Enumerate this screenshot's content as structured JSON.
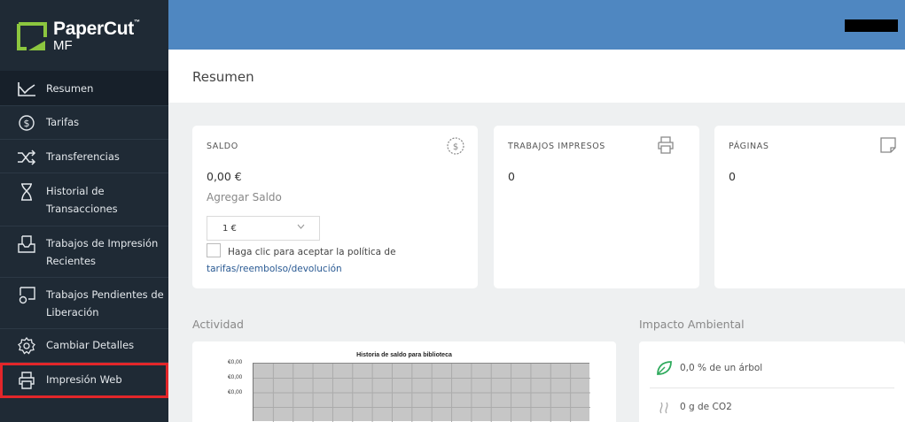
{
  "brand": {
    "name": "PaperCut",
    "trademark": "™",
    "edition": "MF",
    "colors": {
      "green": "#8cc63f",
      "sidebar": "#1f2a35",
      "topbar": "#4f87c1",
      "highlight": "#e3262a",
      "link": "#2a5a93"
    }
  },
  "sidebar": {
    "items": [
      {
        "label": "Resumen",
        "icon": "chart-line-icon",
        "active": true
      },
      {
        "label": "Tarifas",
        "icon": "dollar-circle-icon"
      },
      {
        "label": "Transferencias",
        "icon": "shuffle-icon"
      },
      {
        "label_lines": [
          "Historial de",
          "Transacciones"
        ],
        "icon": "hourglass-icon"
      },
      {
        "label_lines": [
          "Trabajos de Impresión",
          "Recientes"
        ],
        "icon": "tray-icon"
      },
      {
        "label_lines": [
          "Trabajos Pendientes de",
          "Liberación"
        ],
        "icon": "pending-print-icon"
      },
      {
        "label": "Cambiar Detalles",
        "icon": "gear-icon"
      },
      {
        "label": "Impresión Web",
        "icon": "printer-icon",
        "highlighted": true
      }
    ]
  },
  "header": {
    "title": "Resumen"
  },
  "cards": {
    "saldo": {
      "title": "SALDO",
      "icon": "dollar-circle-icon",
      "value": "0,00 €",
      "add_label": "Agregar Saldo",
      "select_value": "1 €",
      "policy_text": "Haga clic para aceptar la política de",
      "policy_link": "tarifas/reembolso/devolución"
    },
    "trabajos": {
      "title": "TRABAJOS IMPRESOS",
      "icon": "printer-icon",
      "value": "0"
    },
    "paginas": {
      "title": "PÁGINAS",
      "icon": "page-icon",
      "value": "0"
    }
  },
  "actividad": {
    "title": "Actividad",
    "chart_data": {
      "type": "line",
      "title": "Historia de saldo para biblioteca",
      "y_tick_labels": [
        "€0,00",
        "€0,00",
        "€0,00"
      ],
      "series": [],
      "grid": true
    }
  },
  "impacto": {
    "title": "Impacto Ambiental",
    "items": [
      {
        "text": "0,0 % de un árbol",
        "icon": "leaf-icon"
      },
      {
        "text": "0 g de CO2",
        "icon": "steam-icon"
      }
    ]
  }
}
